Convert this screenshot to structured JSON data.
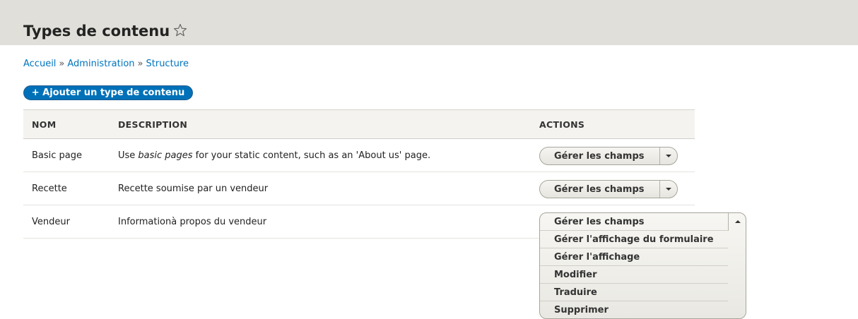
{
  "header": {
    "title": "Types de contenu",
    "favorite_icon": "star-outline-icon"
  },
  "breadcrumb": {
    "items": [
      "Accueil",
      "Administration",
      "Structure"
    ],
    "separator": "»"
  },
  "toolbar": {
    "add_label": "+ Ajouter un type de contenu"
  },
  "table": {
    "columns": [
      "NOM",
      "DESCRIPTION",
      "ACTIONS"
    ],
    "rows": [
      {
        "name": "Basic page",
        "description_parts": [
          "Use ",
          "basic pages",
          " for your static content, such as an 'About us' page."
        ],
        "action": "Gérer les champs"
      },
      {
        "name": "Recette",
        "description": "Recette soumise par un vendeur",
        "action": "Gérer les champs"
      },
      {
        "name": "Vendeur",
        "description": "Informationà propos du vendeur",
        "action": "Gérer les champs"
      }
    ]
  },
  "open_menu": {
    "items": [
      "Gérer les champs",
      "Gérer l'affichage du formulaire",
      "Gérer l'affichage",
      "Modifier",
      "Traduire",
      "Supprimer"
    ]
  },
  "colors": {
    "header_bg": "#e0dfd9",
    "link": "#0074bd",
    "primary_button": "#0071b8"
  }
}
